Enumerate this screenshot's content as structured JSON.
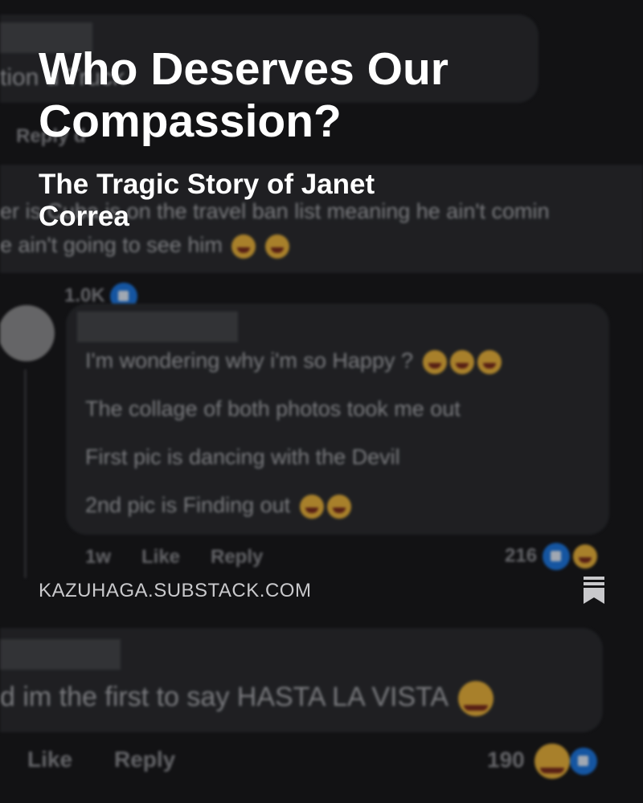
{
  "title": "Who Deserves Our Compassion?",
  "subtitle": "The Tragic Story of Janet Correa",
  "domain_label": "KAZUHAGA.SUBSTACK.COM",
  "bookmark_icon": "bookmark-icon",
  "colors": {
    "overlay_text": "#ffffff",
    "domain_text": "#c9c9cc",
    "like_blue": "#1e77e0"
  },
  "background_comments": {
    "top_fragment": "tion d Truck",
    "top_reply_fragment": "Reply d",
    "second_line_1": "er is Cuba is on the travel ban list meaning he ain't comin",
    "second_line_2": "e ain't going to see him",
    "second_count_fragment": "1.0K",
    "reply_line_1": "I'm wondering why i'm so Happy ?",
    "reply_line_2": "The collage of both photos took me out",
    "reply_line_3": "First pic is dancing with the Devil",
    "reply_line_4": "2nd pic is Finding out",
    "reply_time": "1w",
    "reply_like": "Like",
    "reply_reply": "Reply",
    "reply_count": "216",
    "bottom_line": "d im the first to say HASTA LA VISTA",
    "bottom_like": "Like",
    "bottom_reply": "Reply",
    "bottom_count": "190"
  }
}
